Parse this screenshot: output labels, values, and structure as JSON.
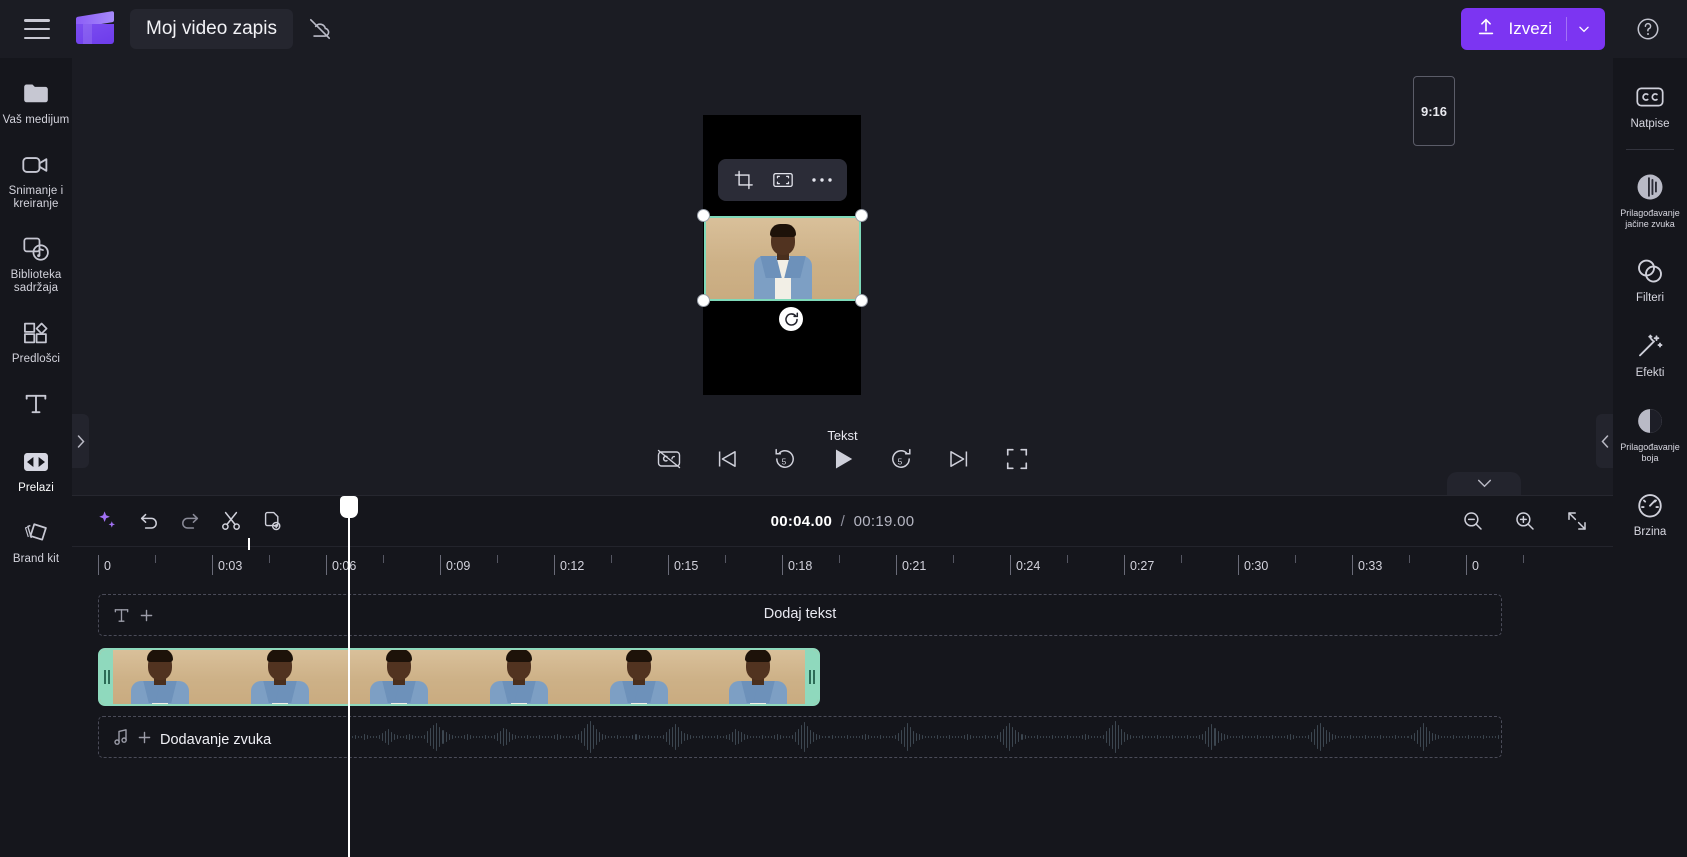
{
  "app": {
    "accent_color": "#7c35f2",
    "selection_color": "#8fd9bd",
    "background": "#15161c"
  },
  "topbar": {
    "menu_icon": "hamburger-menu-icon",
    "logo_icon": "clapperboard-logo",
    "project_title": "Moj video zapis",
    "cloud_icon": "cloud-off-icon",
    "export_label": "Izvezi",
    "export_icon": "upload-arrow-icon",
    "export_chevron": "chevron-down-icon",
    "help_icon": "question-circle-icon"
  },
  "left_rail": {
    "items": [
      {
        "label": "Vaš medijum",
        "icon": "folder-icon"
      },
      {
        "label": "Snimanje i kreiranje",
        "icon": "video-camera-icon"
      },
      {
        "label": "Biblioteka sadržaja",
        "icon": "content-library-icon"
      },
      {
        "label": "Predlošci",
        "icon": "templates-icon"
      },
      {
        "label": "",
        "icon": "text-t-icon"
      },
      {
        "label": "Prelazi",
        "icon": "transitions-icon"
      },
      {
        "label": "Brand kit",
        "icon": "brand-kit-icon"
      }
    ]
  },
  "right_rail": {
    "items": [
      {
        "label": "Natpise",
        "icon": "closed-captions-icon",
        "tiny": false
      },
      {
        "label": "Prilagođavanje jačine zvuka",
        "icon": "audio-fade-icon",
        "tiny": true
      },
      {
        "label": "Filteri",
        "icon": "filters-icon",
        "tiny": false
      },
      {
        "label": "Efekti",
        "icon": "effects-wand-icon",
        "tiny": false
      },
      {
        "label": "Prilagođavanje boja",
        "icon": "color-adjust-icon",
        "tiny": true
      },
      {
        "label": "Brzina",
        "icon": "speedometer-icon",
        "tiny": false
      }
    ]
  },
  "preview": {
    "aspect_ratio": "9:16",
    "clip_toolbar": {
      "crop_icon": "crop-icon",
      "fit_icon": "fit-to-frame-icon",
      "more_icon": "more-options-icon"
    },
    "rotate_icon": "rotate-handle-icon",
    "tooltip": "Tekst",
    "controls": [
      {
        "name": "captions-off-button",
        "icon": "captions-off-icon"
      },
      {
        "name": "skip-to-start-button",
        "icon": "skip-back-icon"
      },
      {
        "name": "rewind-5s-button",
        "icon": "rewind-5-icon"
      },
      {
        "name": "play-button",
        "icon": "play-icon"
      },
      {
        "name": "forward-5s-button",
        "icon": "forward-5-icon"
      },
      {
        "name": "skip-to-end-button",
        "icon": "skip-forward-icon"
      },
      {
        "name": "fullscreen-button",
        "icon": "fullscreen-icon"
      }
    ],
    "left_panel_arrow": "chevron-right-icon",
    "right_panel_arrow": "chevron-left-icon",
    "collapse_tab_icon": "chevron-down-icon"
  },
  "timeline": {
    "toolbar_left": [
      {
        "name": "ai-magic-button",
        "icon": "sparkle-icon"
      },
      {
        "name": "undo-button",
        "icon": "undo-arrow-icon"
      },
      {
        "name": "redo-button",
        "icon": "redo-arrow-icon"
      },
      {
        "name": "split-button",
        "icon": "scissors-icon"
      },
      {
        "name": "duplicate-button",
        "icon": "duplicate-icon"
      }
    ],
    "current_time": "00:04.00",
    "time_separator": "/",
    "total_time": "00:19.00",
    "toolbar_right": [
      {
        "name": "zoom-out-button",
        "icon": "zoom-out-icon"
      },
      {
        "name": "zoom-in-button",
        "icon": "zoom-in-icon"
      },
      {
        "name": "fit-timeline-button",
        "icon": "fit-timeline-icon"
      }
    ],
    "ruler_labels": [
      "0",
      "0:03",
      "0:06",
      "0:09",
      "0:12",
      "0:15",
      "0:18",
      "0:21",
      "0:24",
      "0:27",
      "0:30",
      "0:33",
      "0"
    ],
    "text_track": {
      "icon": "text-t-icon",
      "add_icon": "plus-icon",
      "label": "Dodaj tekst"
    },
    "audio_track": {
      "icon": "music-note-icon",
      "add_icon": "plus-icon",
      "label": "Dodavanje zvuka"
    },
    "video_clip": {
      "name": "video-clip",
      "thumbnails": 6
    },
    "playhead_position_seconds": 4
  }
}
